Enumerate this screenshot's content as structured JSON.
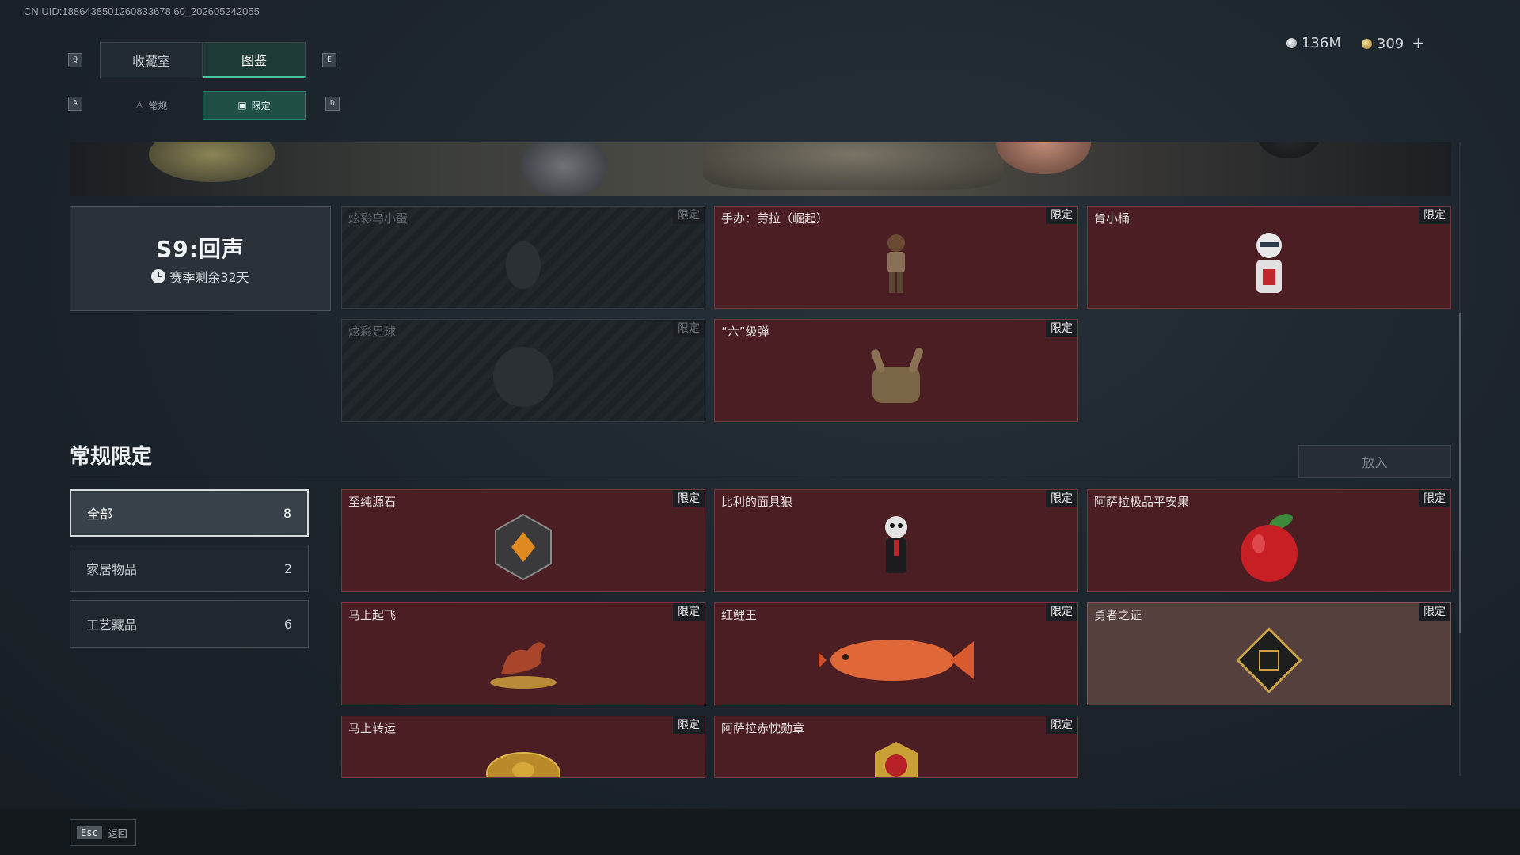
{
  "uid_text": "CN UID:1886438501260833678 60_202605242055",
  "currency": {
    "silver": "136M",
    "gold": "309",
    "plus": "+"
  },
  "keys": {
    "q": "Q",
    "e": "E",
    "a": "A",
    "d": "D"
  },
  "tabs": [
    {
      "label": "收藏室"
    },
    {
      "label": "图鉴"
    }
  ],
  "subtabs": [
    {
      "label": "常规"
    },
    {
      "label": "限定"
    }
  ],
  "season": {
    "title": "S9:回声",
    "remain": "赛季剩余32天"
  },
  "limited_items": [
    {
      "name": "炫彩乌小蛋",
      "tag": "限定"
    },
    {
      "name": "手办：劳拉（崛起）",
      "tag": "限定"
    },
    {
      "name": "肯小桶",
      "tag": "限定"
    },
    {
      "name": "炫彩足球",
      "tag": "限定"
    },
    {
      "name": "“六”级弹",
      "tag": "限定"
    }
  ],
  "section": {
    "title": "常规限定",
    "place_button": "放入"
  },
  "categories": [
    {
      "label": "全部",
      "count": "8"
    },
    {
      "label": "家居物品",
      "count": "2"
    },
    {
      "label": "工艺藏品",
      "count": "6"
    }
  ],
  "items": [
    {
      "name": "至纯源石",
      "tag": "限定"
    },
    {
      "name": "比利的面具狼",
      "tag": "限定"
    },
    {
      "name": "阿萨拉极品平安果",
      "tag": "限定"
    },
    {
      "name": "马上起飞",
      "tag": "限定"
    },
    {
      "name": "红鲤王",
      "tag": "限定"
    },
    {
      "name": "勇者之证",
      "tag": "限定"
    },
    {
      "name": "马上转运",
      "tag": "限定"
    },
    {
      "name": "阿萨拉赤忱勋章",
      "tag": "限定"
    }
  ],
  "footer": {
    "esc_key": "Esc",
    "back_label": "返回"
  },
  "colors": {
    "accent": "#3ec9a0",
    "card_red": "#4a1e22",
    "card_gold": "#56403e"
  }
}
